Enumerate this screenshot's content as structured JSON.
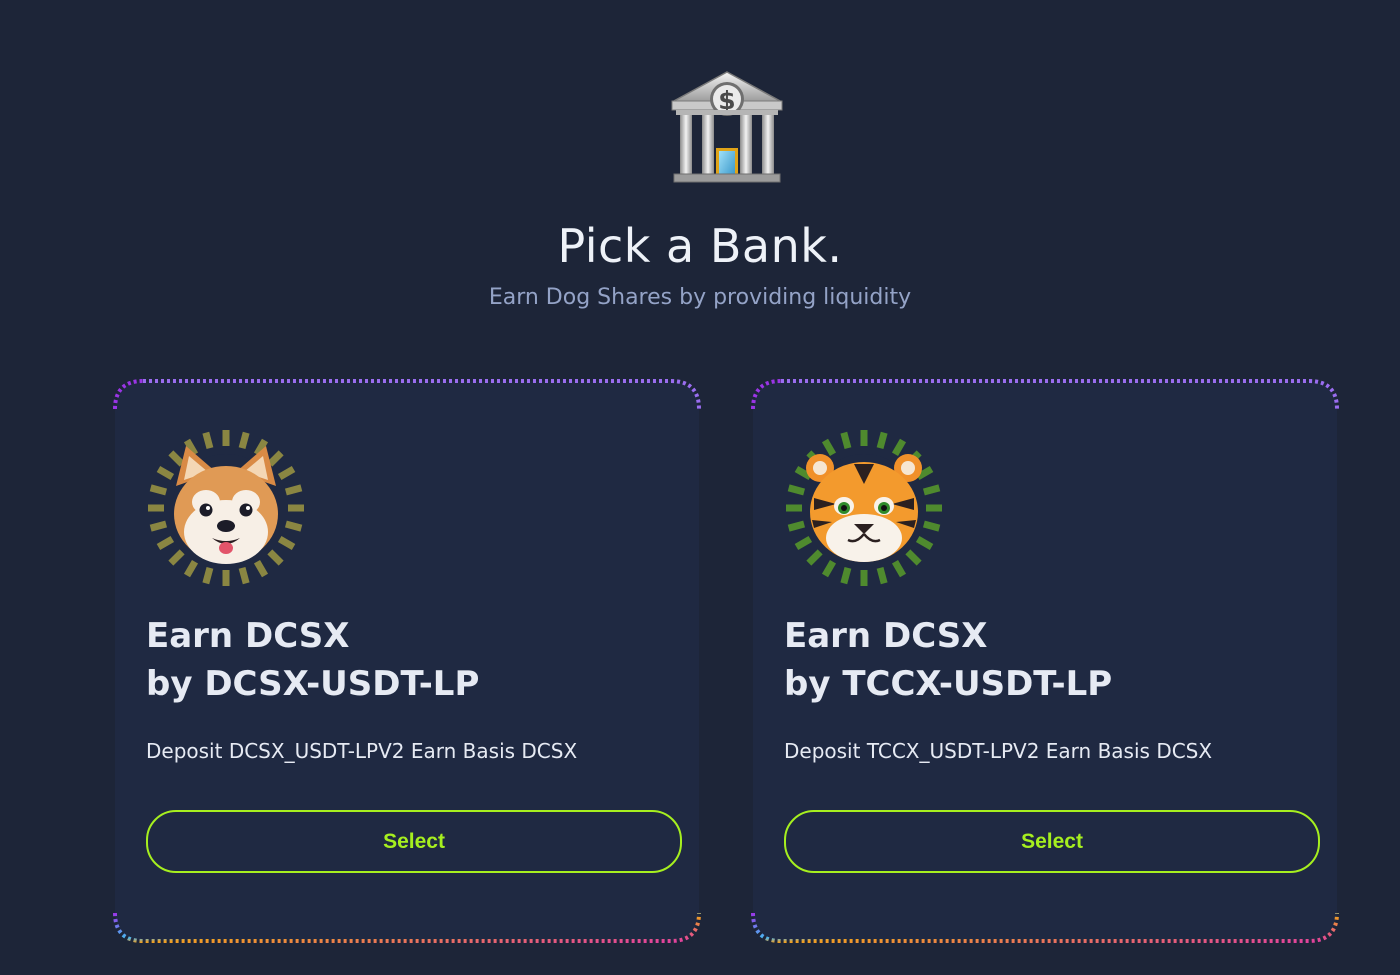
{
  "header": {
    "icon": "bank-icon",
    "title": "Pick a Bank.",
    "subtitle": "Earn Dog Shares by providing liquidity"
  },
  "cards": [
    {
      "icon": "dog-face-icon",
      "title_line1": "Earn DCSX",
      "title_line2": "by DCSX-USDT-LP",
      "description": "Deposit DCSX_USDT-LPV2 Earn Basis DCSX",
      "button_label": "Select",
      "ring_color": "#8a8642"
    },
    {
      "icon": "tiger-face-icon",
      "title_line1": "Earn DCSX",
      "title_line2": "by TCCX-USDT-LP",
      "description": "Deposit TCCX_USDT-LPV2 Earn Basis DCSX",
      "button_label": "Select",
      "ring_color": "#4f8a2e"
    }
  ],
  "colors": {
    "background": "#1d2538",
    "accent": "#a6ef1f",
    "subtitle": "#94a3c7",
    "border_gradient": [
      "#9a35e6",
      "#4ab4f0",
      "#f0a020",
      "#e040a0"
    ]
  }
}
